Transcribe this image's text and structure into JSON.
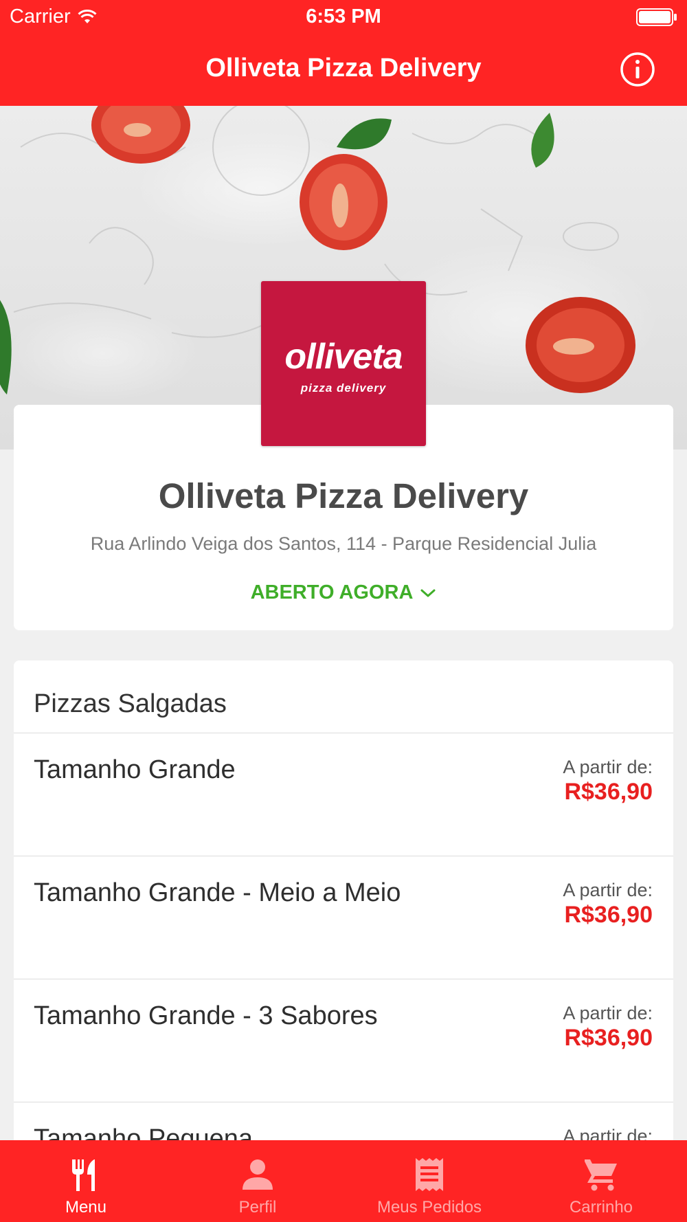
{
  "status_bar": {
    "carrier": "Carrier",
    "time": "6:53 PM"
  },
  "header": {
    "title": "Olliveta Pizza Delivery",
    "info_icon": "info-icon"
  },
  "store": {
    "logo_text": "olliveta",
    "logo_subtext": "pizza delivery",
    "name": "Olliveta Pizza Delivery",
    "address": "Rua Arlindo Veiga dos Santos, 114 - Parque Residencial Julia",
    "open_status": "ABERTO AGORA",
    "open_color": "#3fae29"
  },
  "menu": {
    "category": "Pizzas Salgadas",
    "items": [
      {
        "name": "Tamanho Grande",
        "price_prefix": "A partir de:",
        "price": "R$36,90"
      },
      {
        "name": "Tamanho Grande - Meio a Meio",
        "price_prefix": "A partir de:",
        "price": "R$36,90"
      },
      {
        "name": "Tamanho Grande - 3 Sabores",
        "price_prefix": "A partir de:",
        "price": "R$36,90"
      },
      {
        "name": "Tamanho Pequena",
        "price_prefix": "A partir de:",
        "price": ""
      }
    ]
  },
  "tabs": [
    {
      "label": "Menu",
      "icon": "fork-knife-icon",
      "active": true
    },
    {
      "label": "Perfil",
      "icon": "person-icon",
      "active": false
    },
    {
      "label": "Meus Pedidos",
      "icon": "receipt-icon",
      "active": false
    },
    {
      "label": "Carrinho",
      "icon": "cart-icon",
      "active": false
    }
  ],
  "colors": {
    "brand_red": "#ff2424",
    "logo_bg": "#c5173f",
    "price_red": "#e82020"
  }
}
